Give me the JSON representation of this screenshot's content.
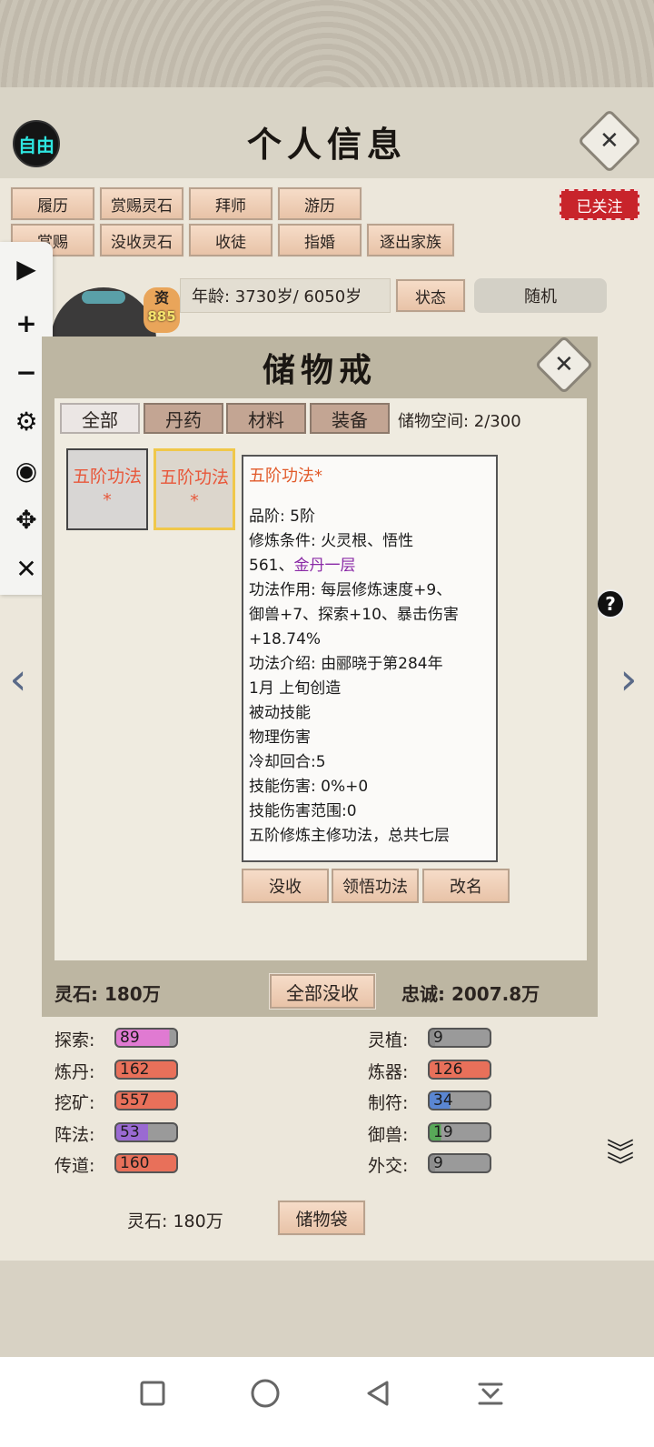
{
  "header": {
    "free_badge": "自由",
    "title": "个人信息",
    "close_label": "✕",
    "followed_label": "已关注"
  },
  "actions_row1": [
    "履历",
    "赏赐灵石",
    "拜师",
    "游历"
  ],
  "actions_row2": [
    "赏赐",
    "没收灵石",
    "收徒",
    "指婚",
    "逐出家族"
  ],
  "profile": {
    "aptitude_label": "资",
    "aptitude_value": "885",
    "age_text": "年龄: 3730岁/ 6050岁",
    "status_button": "状态",
    "random_button": "随机"
  },
  "toolbar_icons": [
    "play-icon",
    "plus-icon",
    "minus-icon",
    "gear-icon",
    "eye-icon",
    "move-icon",
    "close-icon"
  ],
  "storage": {
    "title": "储物戒",
    "close_label": "✕",
    "tabs": [
      "全部",
      "丹药",
      "材料",
      "装备"
    ],
    "capacity": "储物空间: 2/300",
    "slots": [
      {
        "line1": "五阶功法",
        "line2": "*"
      },
      {
        "line1": "五阶功法",
        "line2": "*"
      }
    ],
    "detail": {
      "title": "五阶功法*",
      "grade": "品阶: 5阶",
      "cond1": "修炼条件: 火灵根、悟性",
      "cond2_prefix": "561、",
      "cond2_highlight": "金丹一层",
      "effect1": "功法作用: 每层修炼速度+9、",
      "effect2": "御兽+7、探索+10、暴击伤害",
      "effect3": "+18.74%",
      "intro1": "功法介绍: 由郦晓于第284年",
      "intro2": "1月 上旬创造",
      "passive": "被动技能",
      "damage_type": "物理伤害",
      "cooldown": "冷却回合:5",
      "skill_damage": "技能伤害: 0%+0",
      "skill_range": "技能伤害范围:0",
      "summary": "五阶修炼主修功法，总共七层"
    },
    "buttons": [
      "没收",
      "领悟功法",
      "改名"
    ],
    "spirit_stone": "灵石: 180万",
    "confiscate_all": "全部没收",
    "loyalty": "忠诚: 2007.8万"
  },
  "stats": [
    {
      "label": "探索:",
      "value": "89",
      "color": "#e07ad2",
      "level": 0.89
    },
    {
      "label": "灵植:",
      "value": "9",
      "color": "#8c8c8c",
      "level": 0.09
    },
    {
      "label": "炼丹:",
      "value": "162",
      "color": "#e8705a",
      "level": 1
    },
    {
      "label": "炼器:",
      "value": "126",
      "color": "#e8705a",
      "level": 1
    },
    {
      "label": "挖矿:",
      "value": "557",
      "color": "#e8705a",
      "level": 1
    },
    {
      "label": "制符:",
      "value": "34",
      "color": "#5a86d2",
      "level": 0.34
    },
    {
      "label": "阵法:",
      "value": "53",
      "color": "#9a6ad2",
      "level": 0.53
    },
    {
      "label": "御兽:",
      "value": "19",
      "color": "#58a858",
      "level": 0.19
    },
    {
      "label": "传道:",
      "value": "160",
      "color": "#e8705a",
      "level": 1
    },
    {
      "label": "外交:",
      "value": "9",
      "color": "#8c8c8c",
      "level": 0.09
    }
  ],
  "bottom": {
    "spirit_stone": "灵石: 180万",
    "bag_button": "储物袋"
  },
  "nav_icons": [
    "square-icon",
    "circle-icon",
    "back-triangle-icon",
    "download-icon"
  ]
}
